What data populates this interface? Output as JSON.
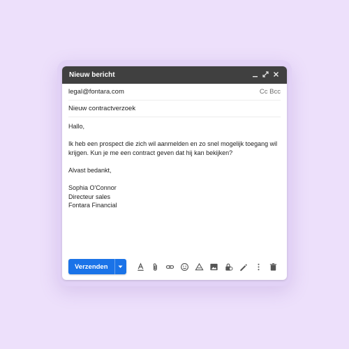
{
  "compose": {
    "title": "Nieuw bericht",
    "to": "legal@fontara.com",
    "cc_bcc": "Cc Bcc",
    "subject": "Nieuw contractverzoek",
    "body": {
      "greeting": "Hallo,",
      "para1_line1": "Ik heb een prospect die zich wil aanmelden en zo snel mogelijk toegang wil",
      "para1_line2": "krijgen. Kun je me een contract geven dat hij kan bekijken?",
      "thanks": "Alvast bedankt,",
      "sig_name": "Sophia O'Connor",
      "sig_title": "Directeur sales",
      "sig_company": "Fontara Financial"
    },
    "send_label": "Verzenden"
  },
  "window_controls": [
    "minimize-icon",
    "expand-icon",
    "close-icon"
  ],
  "toolbar_icons": [
    "format-text-icon",
    "attach-icon",
    "link-icon",
    "emoji-icon",
    "drive-icon",
    "image-icon",
    "confidential-icon",
    "signature-icon",
    "more-options-icon",
    "trash-icon"
  ],
  "colors": {
    "background": "#ede0fb",
    "titlebar": "#404040",
    "send_button": "#1a73e8"
  }
}
